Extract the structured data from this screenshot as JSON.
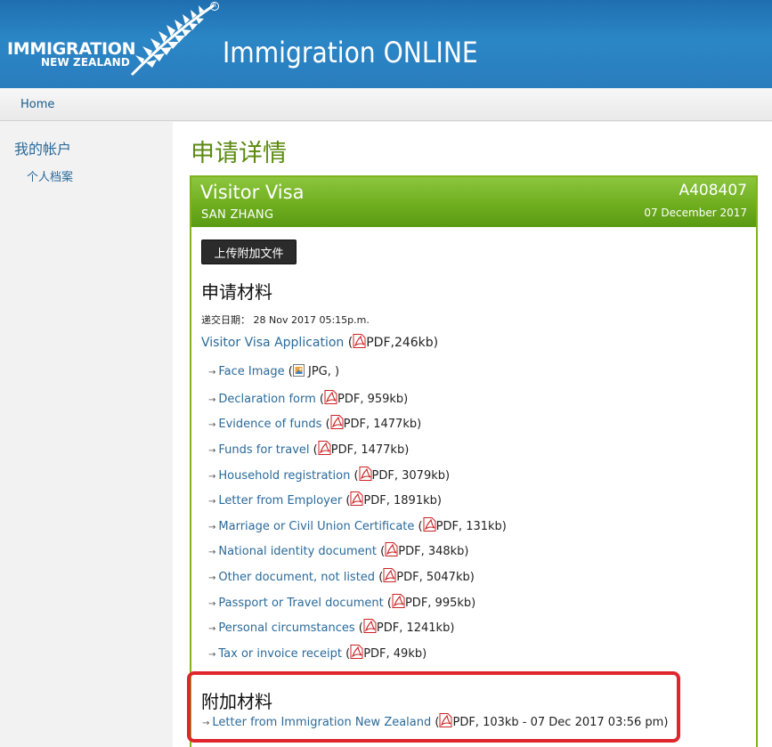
{
  "header": {
    "logo_line1": "IMMIGRATION",
    "logo_line2": "NEW ZEALAND",
    "logo_mark": "R",
    "app_title": "Immigration ONLINE",
    "fern_icon": "silver-fern-icon"
  },
  "nav": {
    "home": "Home"
  },
  "sidebar": {
    "title": "我的帐户",
    "items": [
      "个人档案"
    ]
  },
  "main": {
    "page_title": "申请详情",
    "panel": {
      "visa_type": "Visitor Visa",
      "applicant": "SAN ZHANG",
      "application_number": "A408407",
      "date": "07 December 2017"
    },
    "upload_button": "上传附加文件",
    "materials_title": "申请材料",
    "submit_date_label": "递交日期：",
    "submit_date": "28 Nov 2017  05:15p.m.",
    "main_document": {
      "name": "Visitor Visa Application",
      "meta_open": "(",
      "meta": "PDF,246kb)"
    },
    "documents": [
      {
        "name": "Face Image",
        "meta_open": "(",
        "meta": " JPG, )",
        "icon": "jpg"
      },
      {
        "name": "Declaration form",
        "meta_open": "(",
        "meta": "PDF, 959kb)",
        "icon": "pdf"
      },
      {
        "name": "Evidence of funds",
        "meta_open": "(",
        "meta": "PDF, 1477kb)",
        "icon": "pdf"
      },
      {
        "name": "Funds for travel",
        "meta_open": "(",
        "meta": "PDF, 1477kb)",
        "icon": "pdf"
      },
      {
        "name": "Household registration",
        "meta_open": "(",
        "meta": "PDF, 3079kb)",
        "icon": "pdf"
      },
      {
        "name": "Letter from Employer",
        "meta_open": "(",
        "meta": "PDF, 1891kb)",
        "icon": "pdf"
      },
      {
        "name": "Marriage or Civil Union Certificate",
        "meta_open": "(",
        "meta": "PDF, 131kb)",
        "icon": "pdf"
      },
      {
        "name": "National identity document",
        "meta_open": "(",
        "meta": "PDF, 348kb)",
        "icon": "pdf"
      },
      {
        "name": "Other document, not listed",
        "meta_open": "(",
        "meta": "PDF, 5047kb)",
        "icon": "pdf"
      },
      {
        "name": "Passport or Travel document",
        "meta_open": "(",
        "meta": "PDF, 995kb)",
        "icon": "pdf"
      },
      {
        "name": "Personal circumstances",
        "meta_open": "(",
        "meta": "PDF, 1241kb)",
        "icon": "pdf"
      },
      {
        "name": "Tax or invoice receipt",
        "meta_open": "(",
        "meta": "PDF, 49kb)",
        "icon": "pdf"
      }
    ],
    "additional_title": "附加材料",
    "additional_documents": [
      {
        "name": "Letter from Immigration New Zealand",
        "meta_open": "(",
        "meta": "PDF, 103kb - 07 Dec 2017 03:56 pm)",
        "icon": "pdf"
      }
    ]
  },
  "colors": {
    "header_blue": "#2b86c6",
    "panel_green": "#6fae1f",
    "title_green": "#5b8a10",
    "link_blue": "#2a6a9a",
    "highlight_red": "#e0262d"
  }
}
